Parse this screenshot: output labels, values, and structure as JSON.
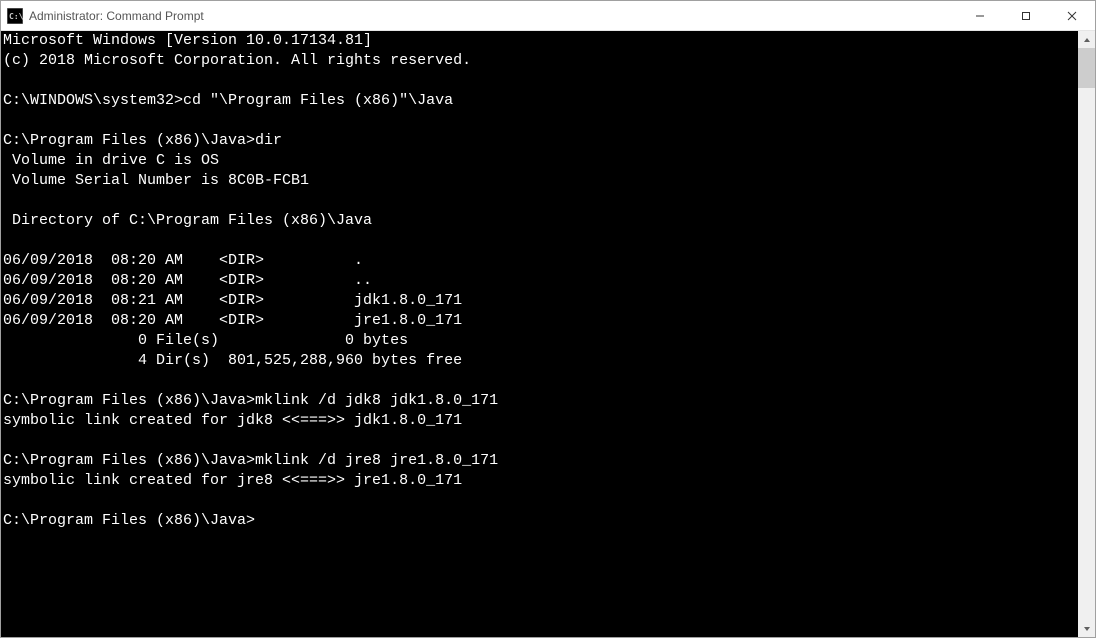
{
  "window": {
    "title": "Administrator: Command Prompt"
  },
  "terminal": {
    "lines": [
      "Microsoft Windows [Version 10.0.17134.81]",
      "(c) 2018 Microsoft Corporation. All rights reserved.",
      "",
      "C:\\WINDOWS\\system32>cd \"\\Program Files (x86)\"\\Java",
      "",
      "C:\\Program Files (x86)\\Java>dir",
      " Volume in drive C is OS",
      " Volume Serial Number is 8C0B-FCB1",
      "",
      " Directory of C:\\Program Files (x86)\\Java",
      "",
      "06/09/2018  08:20 AM    <DIR>          .",
      "06/09/2018  08:20 AM    <DIR>          ..",
      "06/09/2018  08:21 AM    <DIR>          jdk1.8.0_171",
      "06/09/2018  08:20 AM    <DIR>          jre1.8.0_171",
      "               0 File(s)              0 bytes",
      "               4 Dir(s)  801,525,288,960 bytes free",
      "",
      "C:\\Program Files (x86)\\Java>mklink /d jdk8 jdk1.8.0_171",
      "symbolic link created for jdk8 <<===>> jdk1.8.0_171",
      "",
      "C:\\Program Files (x86)\\Java>mklink /d jre8 jre1.8.0_171",
      "symbolic link created for jre8 <<===>> jre1.8.0_171",
      "",
      "C:\\Program Files (x86)\\Java>"
    ]
  },
  "icons": {
    "minimize": "—",
    "maximize": "☐",
    "close": "✕",
    "scroll_up": "▲",
    "scroll_down": "▼"
  }
}
